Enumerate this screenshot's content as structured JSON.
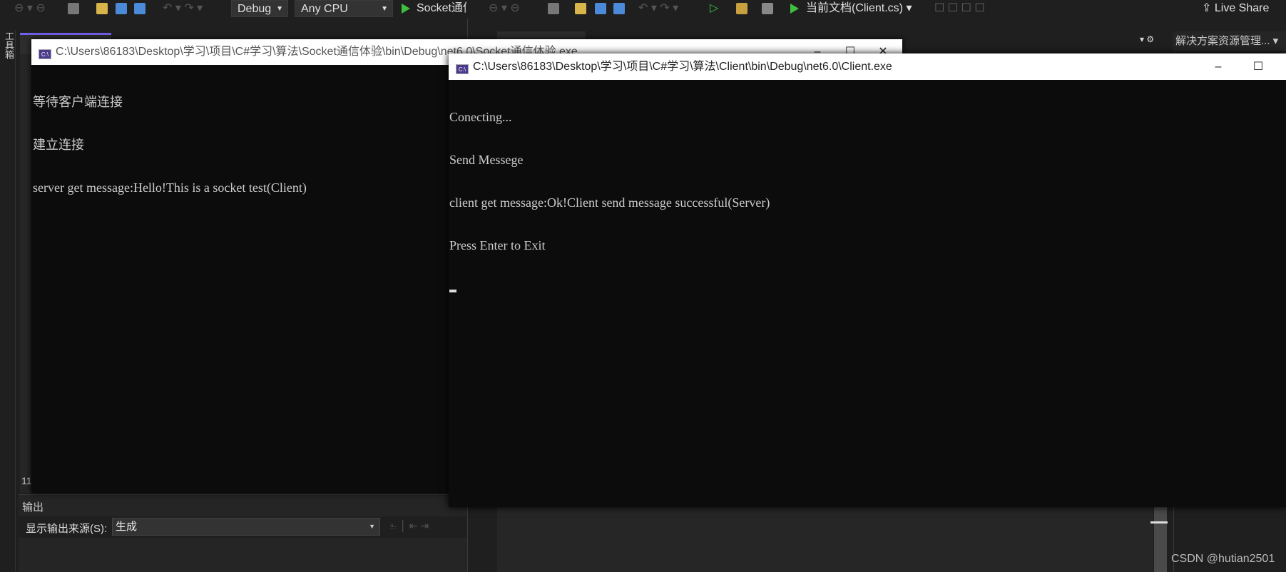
{
  "toolbar_left": {
    "config": "Debug",
    "platform": "Any CPU",
    "run_label": "Socket通信"
  },
  "toolbar_right": {
    "run_label": "当前文档(Client.cs)",
    "live_share": "Live Share"
  },
  "side_strip": {
    "toolbox_label": "工具箱"
  },
  "solution_explorer": {
    "label": "解决方案资源管理..."
  },
  "editor_left": {
    "line_number": "11"
  },
  "server_console": {
    "title": "C:\\Users\\86183\\Desktop\\学习\\项目\\C#学习\\算法\\Socket通信体验\\bin\\Debug\\net6.0\\Socket通信体验.exe",
    "lines": [
      "等待客户端连接",
      "建立连接",
      "server get message:Hello!This is a socket test(Client)"
    ]
  },
  "client_console": {
    "title": "C:\\Users\\86183\\Desktop\\学习\\项目\\C#学习\\算法\\Client\\bin\\Debug\\net6.0\\Client.exe",
    "lines": [
      "Conecting...",
      "Send Messege",
      "client get message:Ok!Client send message successful(Server)",
      "Press Enter to Exit"
    ]
  },
  "output_panel": {
    "title": "输出",
    "source_label": "显示输出来源(S):",
    "source_value": "生成"
  },
  "watermark": "CSDN @hutian2501",
  "colors": {
    "console_bg": "#0c0c0c",
    "ide_bg": "#1f1f1f",
    "run_green": "#3fbf3f"
  }
}
